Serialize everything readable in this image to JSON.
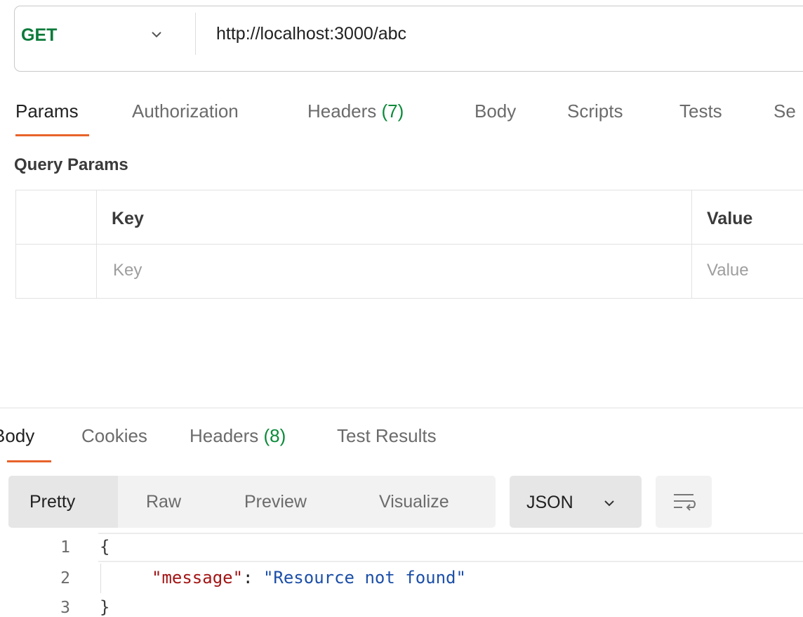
{
  "request": {
    "method": "GET",
    "url": "http://localhost:3000/abc"
  },
  "request_tabs": [
    {
      "label": "Params",
      "count": ""
    },
    {
      "label": "Authorization",
      "count": ""
    },
    {
      "label": "Headers",
      "count": "(7)"
    },
    {
      "label": "Body",
      "count": ""
    },
    {
      "label": "Scripts",
      "count": ""
    },
    {
      "label": "Tests",
      "count": ""
    },
    {
      "label": "Se",
      "count": ""
    }
  ],
  "query_params": {
    "title": "Query Params",
    "columns": [
      "Key",
      "Value"
    ],
    "placeholder_key": "Key",
    "placeholder_value": "Value"
  },
  "response_tabs": [
    {
      "label": "Body",
      "count": ""
    },
    {
      "label": "Cookies",
      "count": ""
    },
    {
      "label": "Headers",
      "count": "(8)"
    },
    {
      "label": "Test Results",
      "count": ""
    }
  ],
  "view_modes": [
    "Pretty",
    "Raw",
    "Preview",
    "Visualize"
  ],
  "format_select": "JSON",
  "code": {
    "line_numbers": [
      "1",
      "2",
      "3"
    ],
    "open_brace": "{",
    "key": "\"message\"",
    "colon": ": ",
    "value": "\"Resource not found\"",
    "close_brace": "}"
  },
  "colors": {
    "method_get": "#0b7a3a",
    "active_tab_underline": "#e8632a",
    "count_green": "#0b8a3a",
    "json_key": "#a31515",
    "json_string": "#1c4fa8"
  },
  "icons": {
    "method_dropdown": "chevron-down-icon",
    "format_dropdown": "chevron-down-icon",
    "wrap": "wrap-lines-icon"
  }
}
